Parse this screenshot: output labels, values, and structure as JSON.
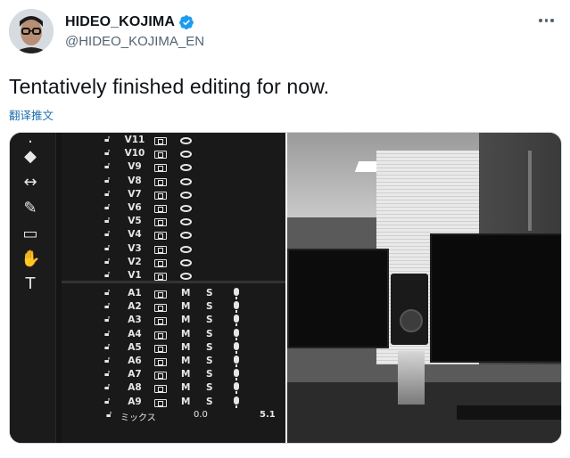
{
  "author": {
    "display_name": "HIDEO_KOJIMA",
    "handle": "@HIDEO_KOJIMA_EN",
    "verified": true,
    "verified_color": "#1d9bf0"
  },
  "tweet": {
    "text": "Tentatively finished editing for now.",
    "translate_label": "翻译推文"
  },
  "icons": {
    "more": "more-options-icon",
    "verified": "verified-badge-icon"
  },
  "media": {
    "left_image": {
      "tools": [
        "move",
        "width",
        "pen",
        "rectangle",
        "hand",
        "type"
      ],
      "video_tracks": [
        "V11",
        "V10",
        "V9",
        "V8",
        "V7",
        "V6",
        "V5",
        "V4",
        "V3",
        "V2",
        "V1"
      ],
      "audio_tracks": [
        "A1",
        "A2",
        "A3",
        "A4",
        "A5",
        "A6",
        "A7",
        "A8",
        "A9"
      ],
      "audio_mute_label": "M",
      "audio_solo_label": "S",
      "mix_label": "ミックス",
      "mix_value": "0.0",
      "mix_channels": "5.1"
    },
    "right_image": {
      "description_name": "office-desk-photo"
    }
  }
}
